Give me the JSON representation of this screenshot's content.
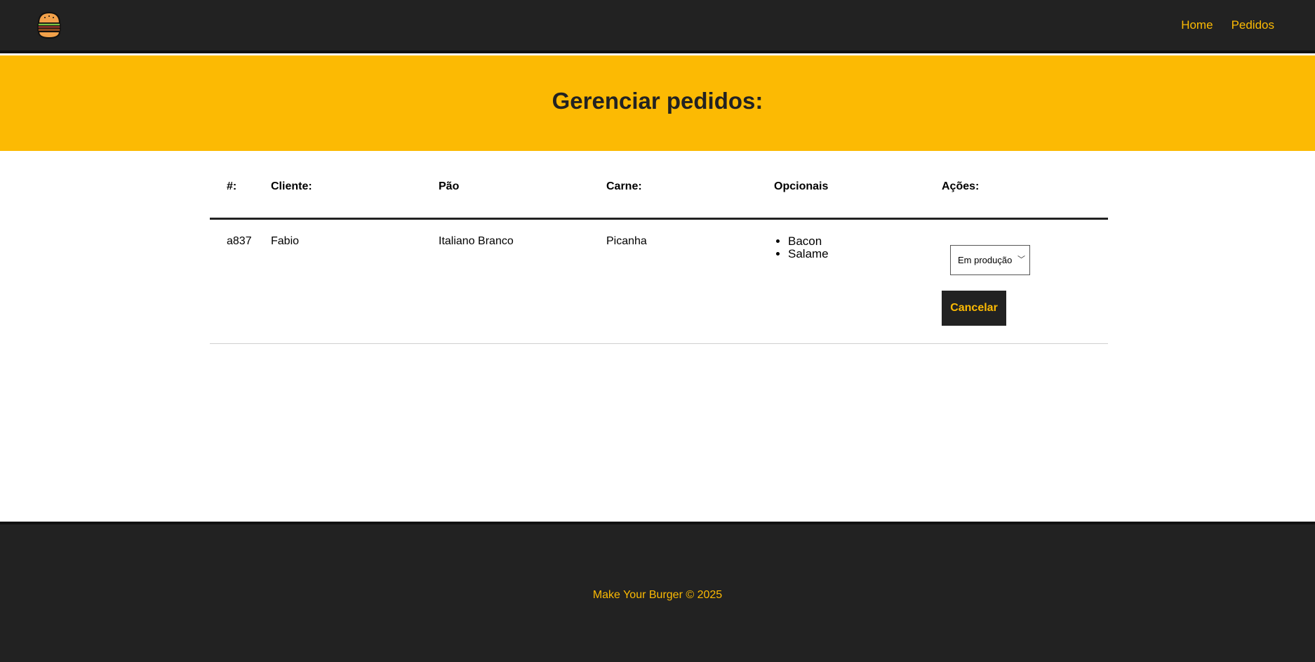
{
  "colors": {
    "accent": "#fcba03",
    "dark": "#222222",
    "white": "#ffffff"
  },
  "navbar": {
    "logo_icon": "burger-icon",
    "links": [
      {
        "label": "Home"
      },
      {
        "label": "Pedidos"
      }
    ]
  },
  "banner": {
    "title": "Gerenciar pedidos:"
  },
  "table": {
    "headers": {
      "id": "#:",
      "client": "Cliente:",
      "bread": "Pão",
      "meat": "Carne:",
      "optionals": "Opcionais",
      "actions": "Ações:"
    },
    "rows": [
      {
        "id": "a837",
        "client": "Fabio",
        "bread": "Italiano Branco",
        "meat": "Picanha",
        "optionals": [
          "Bacon",
          "Salame"
        ],
        "status": "Em produção",
        "cancel_label": "Cancelar"
      }
    ]
  },
  "footer": {
    "text": "Make Your Burger © 2025"
  }
}
